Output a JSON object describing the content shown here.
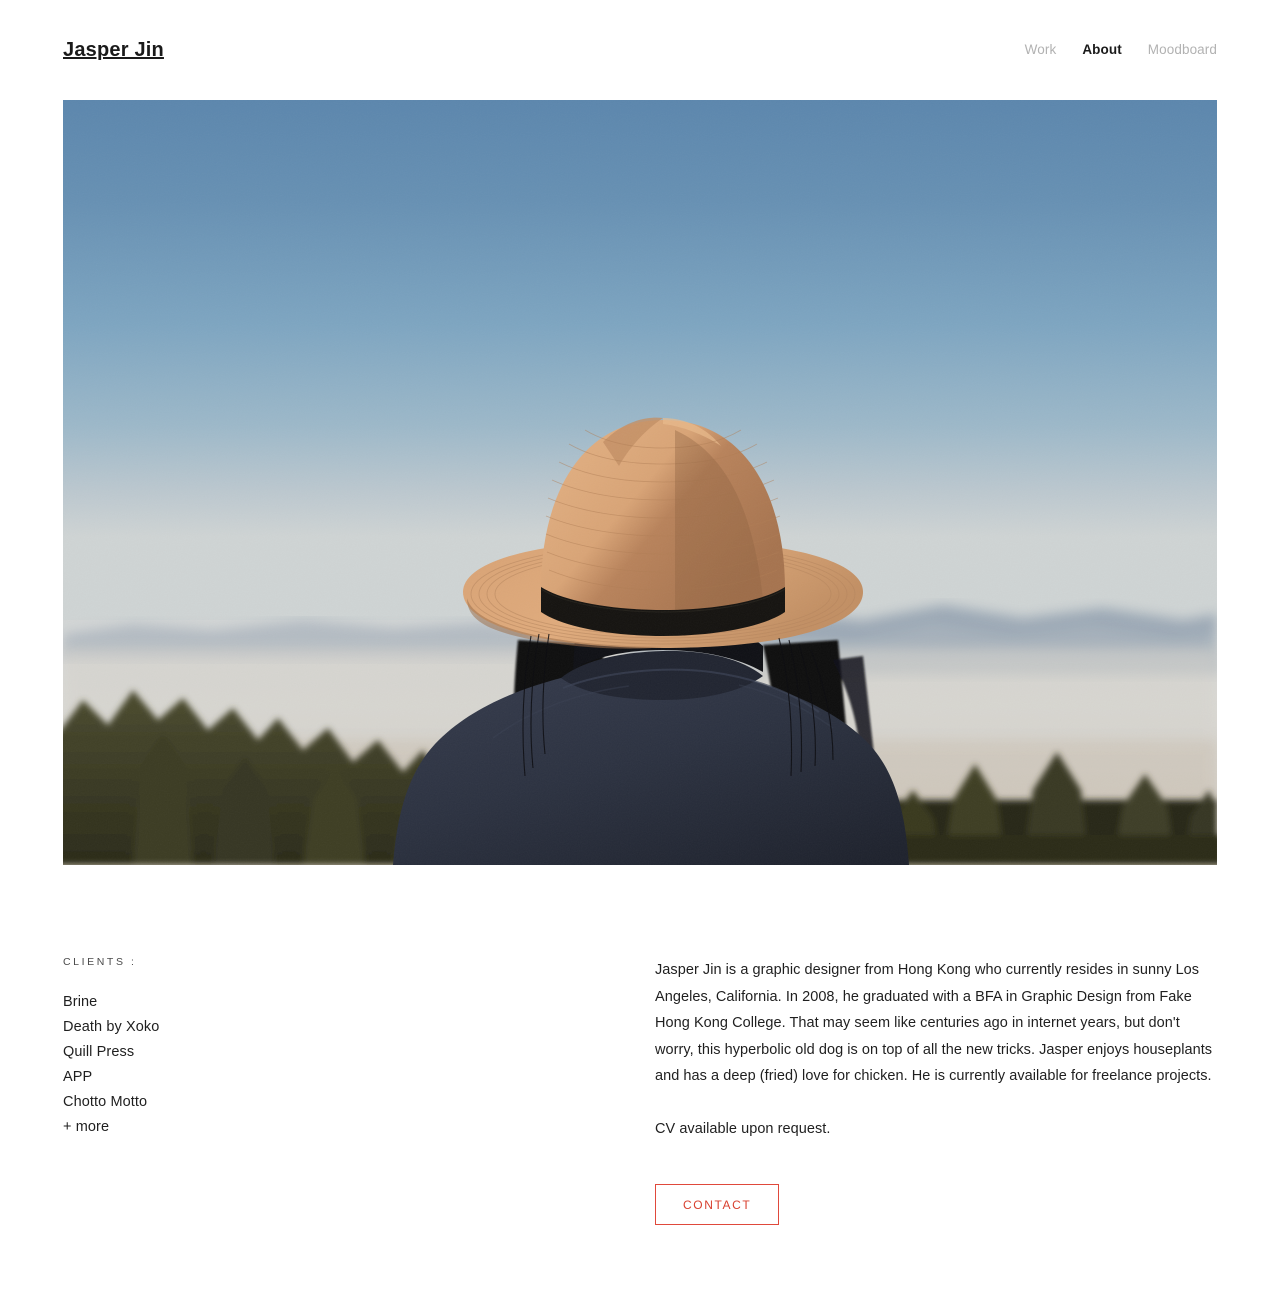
{
  "header": {
    "logo": "Jasper Jin",
    "nav": [
      {
        "label": "Work",
        "active": false
      },
      {
        "label": "About",
        "active": true
      },
      {
        "label": "Moodboard",
        "active": false
      }
    ]
  },
  "hero": {
    "alt": "Person seen from behind wearing a straw fedora hat with black band and a dark navy wool coat, looking out over a hazy valley with pine trees and distant blue mountains under a clear blue sky",
    "colors": {
      "sky_top": "#5c87ad",
      "sky_mid": "#7fa3c0",
      "sky_horizon": "#c5ccd2",
      "haze": "#dcdcd9",
      "mountains": "#8e9aa8",
      "trees": "#3b3a24",
      "hat_straw": "#d9a373",
      "hat_shadow": "#b27f55",
      "hat_band": "#161410",
      "coat": "#2b3040",
      "hair": "#0d0d10"
    }
  },
  "clients": {
    "label": "CLIENTS :",
    "items": [
      "Brine",
      "Death by Xoko",
      "Quill Press",
      "APP",
      "Chotto Motto",
      "+ more"
    ]
  },
  "bio": {
    "paragraphs": [
      "Jasper Jin is a graphic designer from Hong Kong who currently resides in sunny Los Angeles, California. In 2008, he graduated with a BFA in Graphic Design from Fake Hong Kong College. That may seem like centuries ago in internet years, but don't worry, this hyperbolic old dog is on top of all the new tricks. Jasper enjoys houseplants and has a deep (fried) love for chicken. He is currently available for freelance projects.",
      "CV available upon request."
    ]
  },
  "contact": {
    "label": "CONTACT",
    "accent_color": "#e0493b"
  }
}
